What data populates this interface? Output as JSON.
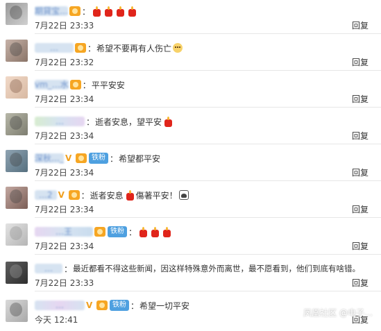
{
  "comments": [
    {
      "name": "期貸宝…",
      "text": "",
      "emojis": [
        "candle",
        "candle",
        "candle",
        "candle"
      ],
      "time": "7月22日 23:33",
      "reply": "回复",
      "badges": [
        "vip"
      ]
    },
    {
      "name": "…",
      "text": "希望不要再有人伤亡",
      "emojis": [
        "sad"
      ],
      "time": "7月22日 23:32",
      "reply": "回复",
      "badges": [
        "vip"
      ]
    },
    {
      "name": "vm_…水",
      "text": "平平安安",
      "emojis": [],
      "time": "7月22日 23:34",
      "reply": "回复",
      "badges": [
        "vip"
      ]
    },
    {
      "name": "…",
      "text": "逝者安息，望平安",
      "emojis": [
        "candle"
      ],
      "time": "7月22日 23:34",
      "reply": "回复",
      "badges": []
    },
    {
      "name": "深秋…_",
      "text": "希望都平安",
      "emojis": [],
      "time": "7月22日 23:34",
      "reply": "回复",
      "badges": [
        "v",
        "vip",
        "fan"
      ]
    },
    {
      "name": "…2",
      "text": "逝者安息",
      "text2": "傷著平安！",
      "emojis": [
        "candle"
      ],
      "emojis_end": [
        "hat"
      ],
      "time": "7月22日 23:34",
      "reply": "回复",
      "badges": [
        "v",
        "vip"
      ]
    },
    {
      "name": "…王",
      "text": "",
      "emojis": [
        "candle",
        "candle",
        "candle"
      ],
      "time": "7月22日 23:34",
      "reply": "回复",
      "badges": [
        "vip",
        "fan"
      ]
    },
    {
      "name": "…",
      "text": "最近都看不得这些新闻，因这样特殊意外而离世，最不愿看到，他们到底有啥错。",
      "emojis": [],
      "time": "7月22日 23:33",
      "reply": "回复",
      "badges": []
    },
    {
      "name": "…",
      "text": "希望一切平安",
      "emojis": [],
      "time": "今天 12:41",
      "reply": "回复",
      "badges": [
        "v",
        "vip",
        "fan"
      ]
    }
  ],
  "fan_label": "铁粉",
  "colon": "：",
  "watermark": "凤凰社区 @电子…"
}
